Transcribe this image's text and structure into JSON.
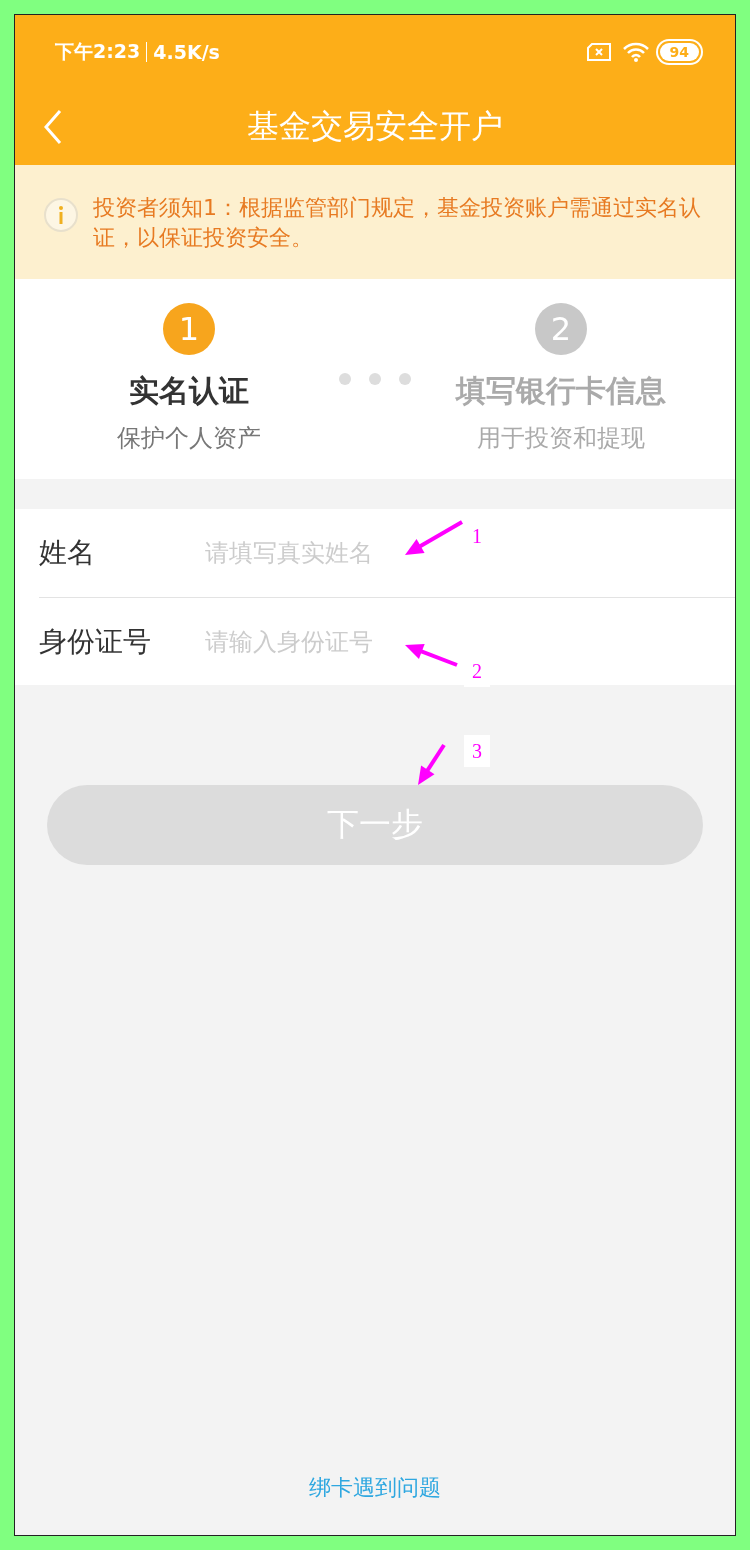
{
  "status_bar": {
    "time": "下午2:23",
    "speed": "4.5K/s",
    "battery": "94"
  },
  "nav": {
    "title": "基金交易安全开户"
  },
  "notice": {
    "text": "投资者须知1：根据监管部门规定，基金投资账户需通过实名认证，以保证投资安全。"
  },
  "steps": [
    {
      "number": "1",
      "title": "实名认证",
      "subtitle": "保护个人资产",
      "selected": true
    },
    {
      "number": "2",
      "title": "填写银行卡信息",
      "subtitle": "用于投资和提现",
      "selected": false
    }
  ],
  "fields": [
    {
      "label": "姓名",
      "placeholder": "请填写真实姓名"
    },
    {
      "label": "身份证号",
      "placeholder": "请输入身份证号"
    }
  ],
  "next_button": {
    "label": "下一步",
    "disabled": true
  },
  "footer_link": "绑卡遇到问题",
  "annotations": [
    {
      "label": "1"
    },
    {
      "label": "2"
    },
    {
      "label": "3"
    }
  ]
}
